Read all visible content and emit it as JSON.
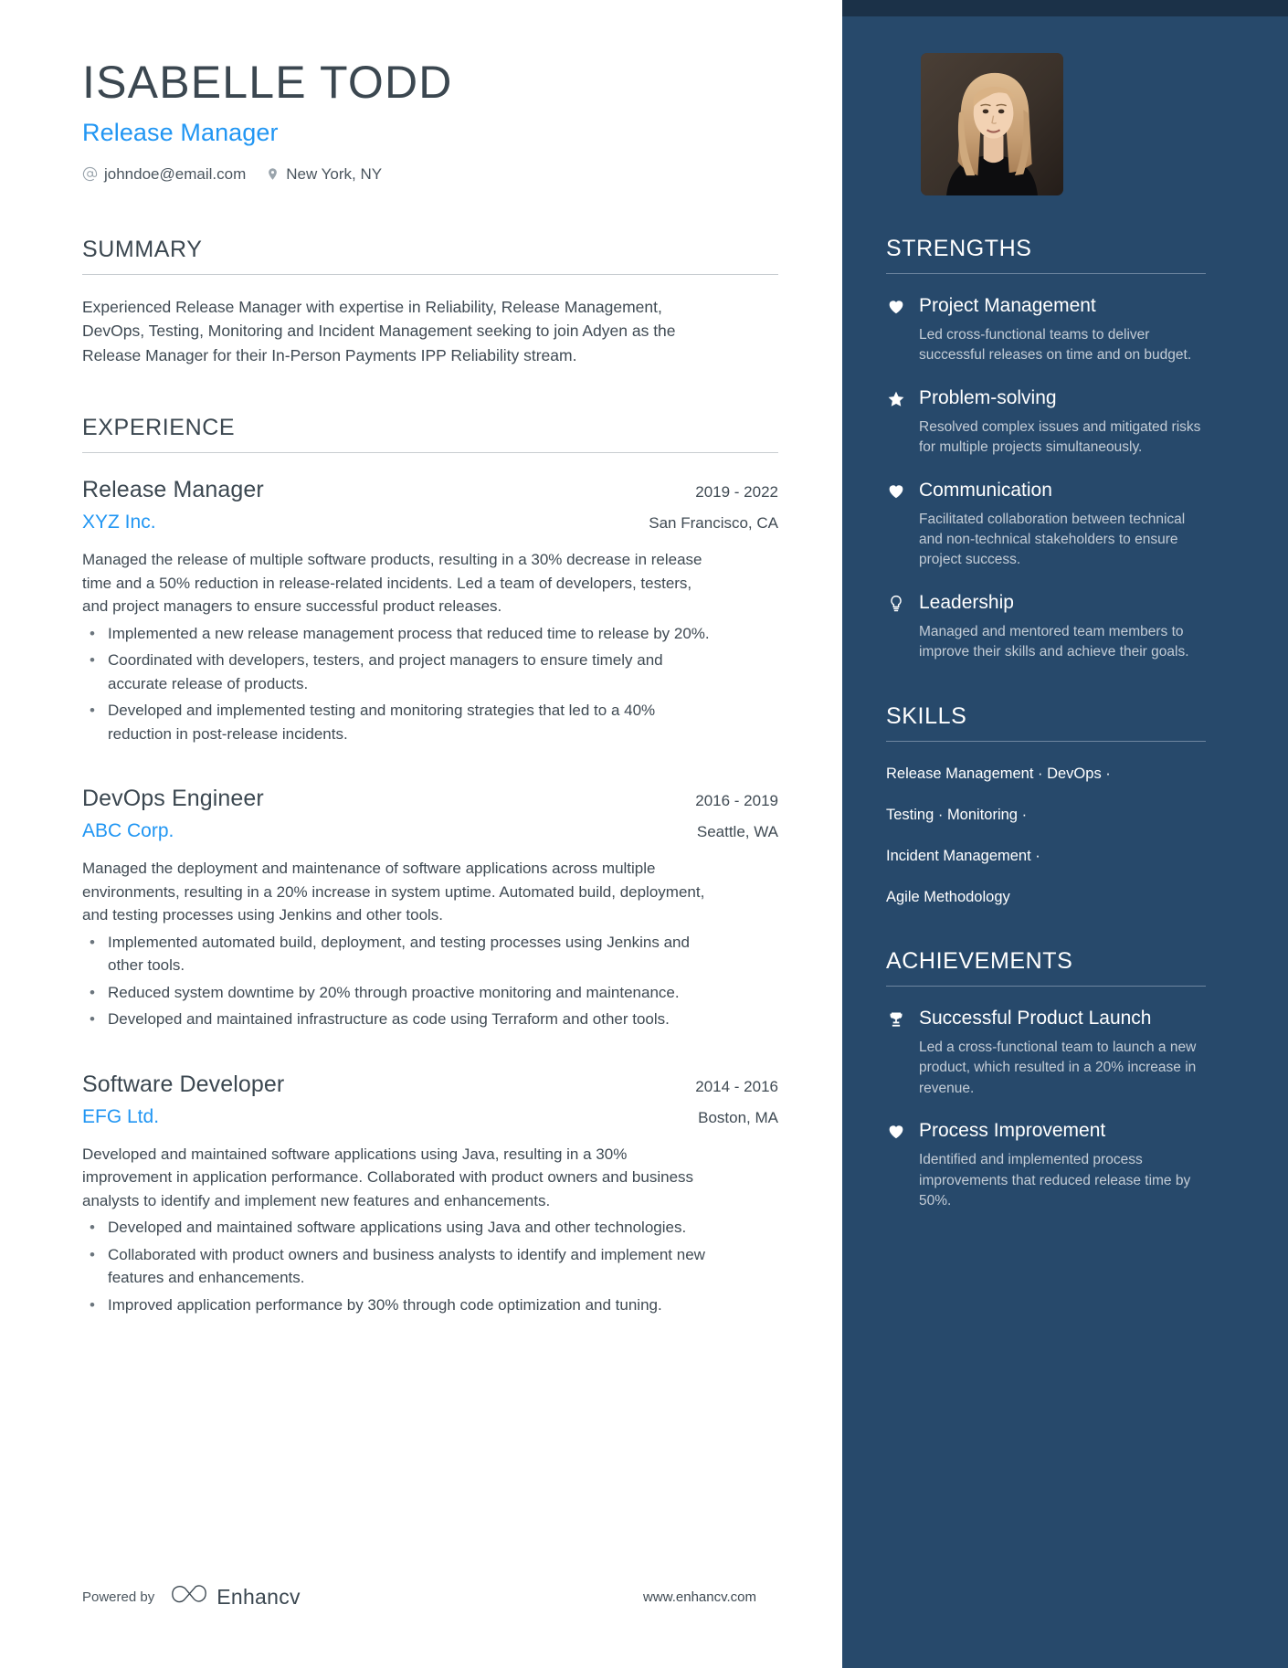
{
  "header": {
    "name": "ISABELLE TODD",
    "role": "Release Manager",
    "email": "johndoe@email.com",
    "location": "New York, NY",
    "email_icon": "at-icon",
    "location_icon": "map-pin-icon"
  },
  "summary": {
    "title": "SUMMARY",
    "text": "Experienced Release Manager with expertise in Reliability, Release Management, DevOps, Testing, Monitoring and Incident Management seeking to join Adyen as the Release Manager for their In-Person Payments IPP Reliability stream."
  },
  "experience": {
    "title": "EXPERIENCE",
    "jobs": [
      {
        "title": "Release Manager",
        "dates": "2019 - 2022",
        "company": "XYZ Inc.",
        "location": "San Francisco, CA",
        "description": "Managed the release of multiple software products, resulting in a 30% decrease in release time and a 50% reduction in release-related incidents. Led a team of developers, testers, and project managers to ensure successful product releases.",
        "bullets": [
          "Implemented a new release management process that reduced time to release by 20%.",
          "Coordinated with developers, testers, and project managers to ensure timely and accurate release of products.",
          "Developed and implemented testing and monitoring strategies that led to a 40% reduction in post-release incidents."
        ]
      },
      {
        "title": "DevOps Engineer",
        "dates": "2016 - 2019",
        "company": "ABC Corp.",
        "location": "Seattle, WA",
        "description": "Managed the deployment and maintenance of software applications across multiple environments, resulting in a 20% increase in system uptime. Automated build, deployment, and testing processes using Jenkins and other tools.",
        "bullets": [
          "Implemented automated build, deployment, and testing processes using Jenkins and other tools.",
          "Reduced system downtime by 20% through proactive monitoring and maintenance.",
          "Developed and maintained infrastructure as code using Terraform and other tools."
        ]
      },
      {
        "title": "Software Developer",
        "dates": "2014 - 2016",
        "company": "EFG Ltd.",
        "location": "Boston, MA",
        "description": "Developed and maintained software applications using Java, resulting in a 30% improvement in application performance. Collaborated with product owners and business analysts to identify and implement new features and enhancements.",
        "bullets": [
          "Developed and maintained software applications using Java and other technologies.",
          "Collaborated with product owners and business analysts to identify and implement new features and enhancements.",
          "Improved application performance by 30% through code optimization and tuning."
        ]
      }
    ]
  },
  "sidebar": {
    "photo_alt": "portrait-photo",
    "strengths": {
      "title": "STRENGTHS",
      "items": [
        {
          "icon": "heart-icon",
          "name": "Project Management",
          "desc": "Led cross-functional teams to deliver successful releases on time and on budget."
        },
        {
          "icon": "star-icon",
          "name": "Problem-solving",
          "desc": "Resolved complex issues and mitigated risks for multiple projects simultaneously."
        },
        {
          "icon": "heart-icon",
          "name": "Communication",
          "desc": "Facilitated collaboration between technical and non-technical stakeholders to ensure project success."
        },
        {
          "icon": "lightbulb-icon",
          "name": "Leadership",
          "desc": "Managed and mentored team members to improve their skills and achieve their goals."
        }
      ]
    },
    "skills": {
      "title": "SKILLS",
      "lines": [
        "Release Management · DevOps ·",
        "Testing · Monitoring ·",
        "Incident Management ·",
        "Agile Methodology"
      ]
    },
    "achievements": {
      "title": "ACHIEVEMENTS",
      "items": [
        {
          "icon": "trophy-icon",
          "name": "Successful Product Launch",
          "desc": "Led a cross-functional team to launch a new product, which resulted in a 20% increase in revenue."
        },
        {
          "icon": "heart-icon",
          "name": "Process Improvement",
          "desc": "Identified and implemented process improvements that reduced release time by 50%."
        }
      ]
    }
  },
  "footer": {
    "powered_by": "Powered by",
    "brand": "Enhancv",
    "brand_icon": "enhancv-logo-icon",
    "website": "www.enhancv.com"
  },
  "colors": {
    "accent_blue": "#2196f3",
    "sidebar_navy": "#27496b",
    "sidebar_top": "#1b3148",
    "text_dark": "#3b4750"
  }
}
